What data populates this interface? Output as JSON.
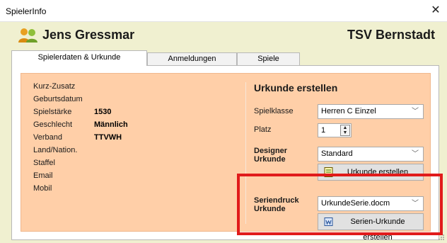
{
  "window": {
    "title": "SpielerInfo"
  },
  "header": {
    "player_name": "Jens Gressmar",
    "club_name": "TSV Bernstadt"
  },
  "tabs": [
    {
      "label": "Spielerdaten & Urkunde",
      "active": true
    },
    {
      "label": "Anmeldungen",
      "active": false
    },
    {
      "label": "Spiele",
      "active": false
    }
  ],
  "player_fields": [
    {
      "label": "Kurz-Zusatz",
      "value": ""
    },
    {
      "label": "Geburtsdatum",
      "value": ""
    },
    {
      "label": "Spielstärke",
      "value": "1530"
    },
    {
      "label": "Geschlecht",
      "value": "Männlich"
    },
    {
      "label": "Verband",
      "value": "TTVWH"
    },
    {
      "label": "Land/Nation.",
      "value": ""
    },
    {
      "label": "Staffel",
      "value": ""
    },
    {
      "label": "Email",
      "value": ""
    },
    {
      "label": "Mobil",
      "value": ""
    }
  ],
  "certificate": {
    "heading": "Urkunde erstellen",
    "spielklasse_label": "Spielklasse",
    "spielklasse_value": "Herren C Einzel",
    "platz_label": "Platz",
    "platz_value": "1",
    "designer_label_1": "Designer",
    "designer_label_2": "Urkunde",
    "designer_value": "Standard",
    "designer_button": "Urkunde erstellen",
    "serial_label_1": "Seriendruck",
    "serial_label_2": "Urkunde",
    "serial_value": "UrkundeSerie.docm",
    "serial_button": "Serien-Urkunde erstellen"
  },
  "colors": {
    "window_bg": "#f0f0d0",
    "panel_bg": "#ffcfa8",
    "highlight": "#e11b1b"
  }
}
